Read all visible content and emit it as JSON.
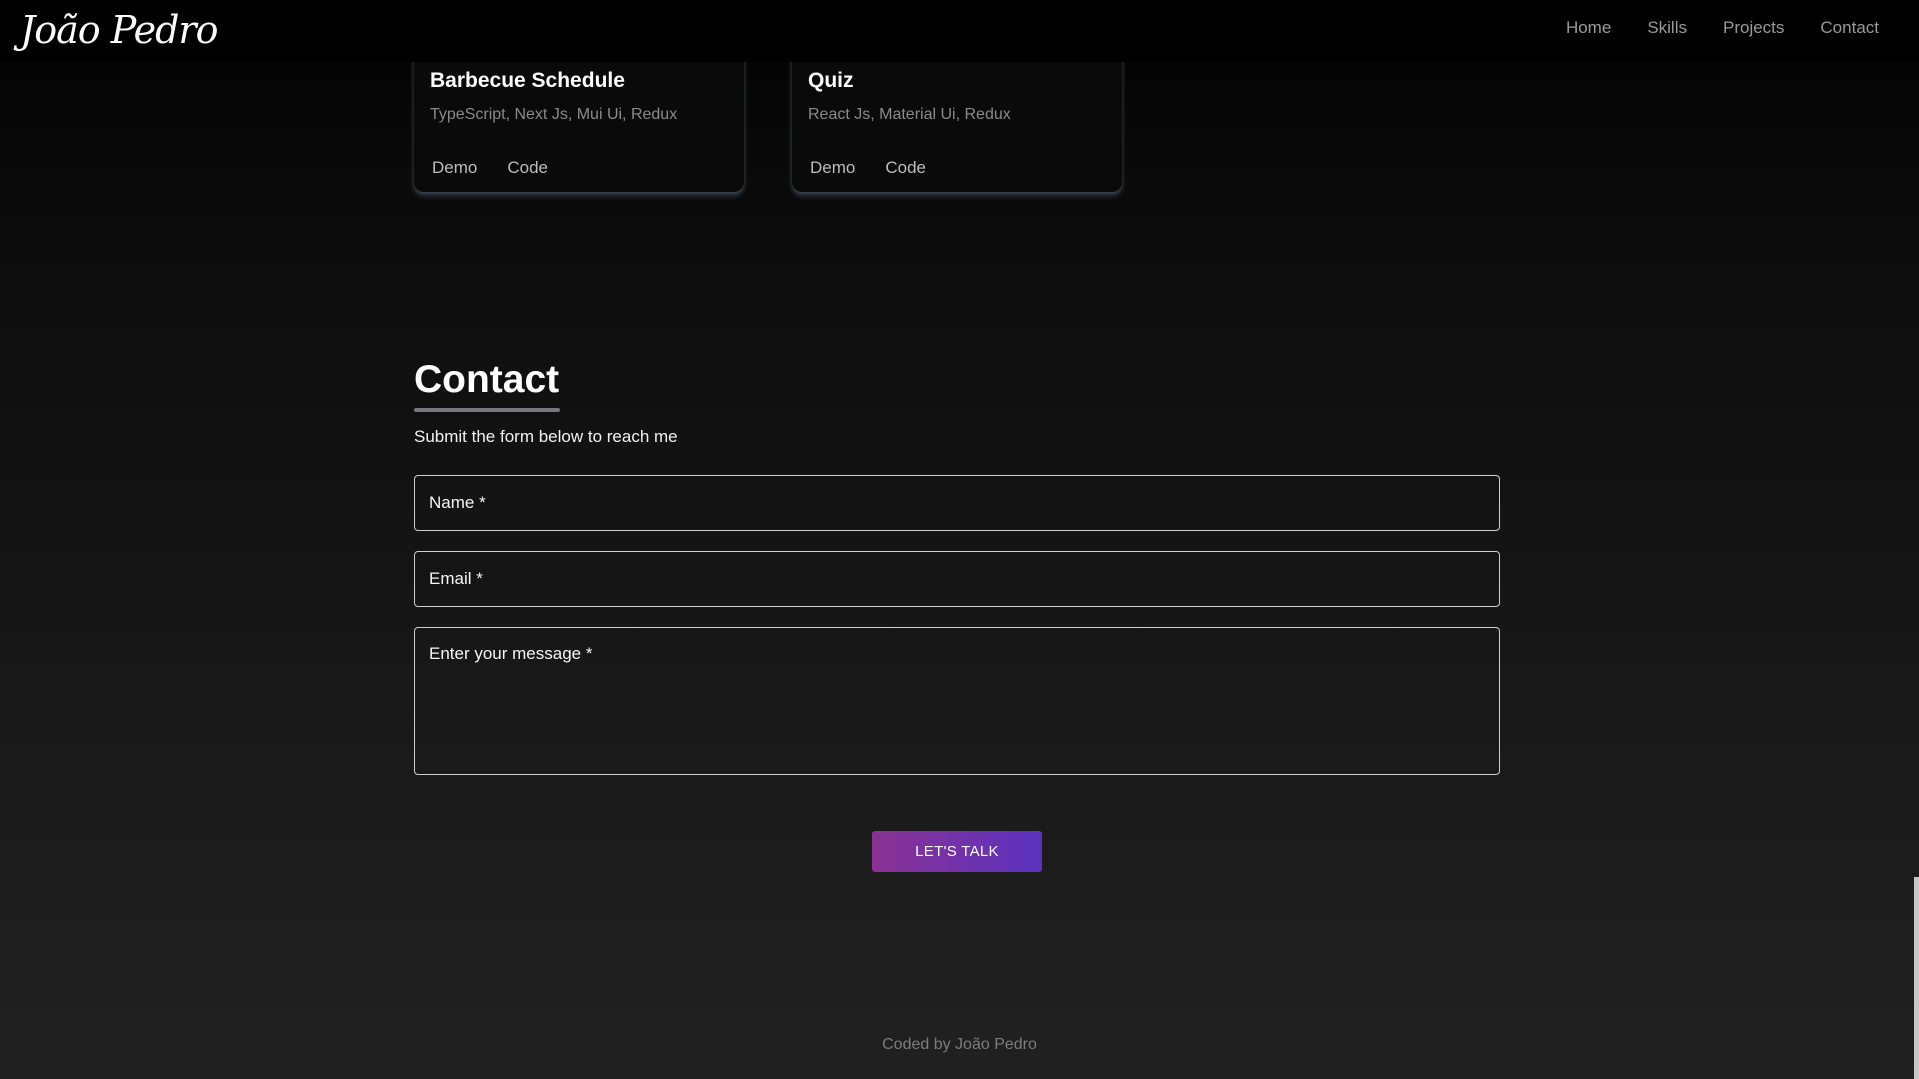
{
  "header": {
    "logo": "João Pedro",
    "nav": [
      "Home",
      "Skills",
      "Projects",
      "Contact"
    ]
  },
  "projects": [
    {
      "title": "Barbecue Schedule",
      "tech": "TypeScript, Next Js, Mui Ui, Redux",
      "demo_label": "Demo",
      "code_label": "Code"
    },
    {
      "title": "Quiz",
      "tech": "React Js, Material Ui, Redux",
      "demo_label": "Demo",
      "code_label": "Code"
    }
  ],
  "contact": {
    "title": "Contact",
    "subtitle": "Submit the form below to reach me",
    "name_placeholder": "Name *",
    "email_placeholder": "Email *",
    "message_placeholder": "Enter your message *",
    "submit_label": "LET'S TALK"
  },
  "footer": {
    "text": "Coded by João Pedro"
  },
  "colors": {
    "accent_start": "#8a3192",
    "accent_end": "#5b32c0"
  }
}
